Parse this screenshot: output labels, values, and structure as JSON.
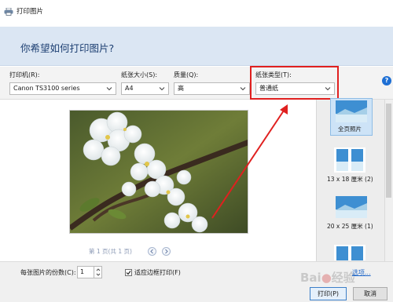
{
  "window": {
    "title": "打印图片",
    "icon": "printer-icon"
  },
  "header": {
    "heading": "你希望如何打印图片?"
  },
  "settings": {
    "printer": {
      "label": "打印机(R):",
      "value": "Canon TS3100 series"
    },
    "paper_size": {
      "label": "纸张大小(S):",
      "value": "A4"
    },
    "quality": {
      "label": "质量(Q):",
      "value": "高"
    },
    "paper_type": {
      "label": "纸张类型(T):",
      "value": "普通纸"
    },
    "help_glyph": "?"
  },
  "preview": {
    "page_info": "第 1 页(共 1 页)"
  },
  "layouts": [
    {
      "label": "全页照片",
      "selected": true
    },
    {
      "label": "13 x 18 厘米 (2)",
      "selected": false
    },
    {
      "label": "20 x 25 厘米 (1)",
      "selected": false
    }
  ],
  "bottom": {
    "copies_label": "每张图片的份数(C):",
    "copies_value": "1",
    "fit_frame_label": "适应边框打印(F)",
    "fit_frame_checked": true,
    "options_link": "选项...",
    "print_button": "打印(P)",
    "cancel_button": "取消"
  },
  "colors": {
    "highlight": "#e0201f",
    "accent": "#1e6fd4",
    "header_bg": "#dbe6f3"
  }
}
